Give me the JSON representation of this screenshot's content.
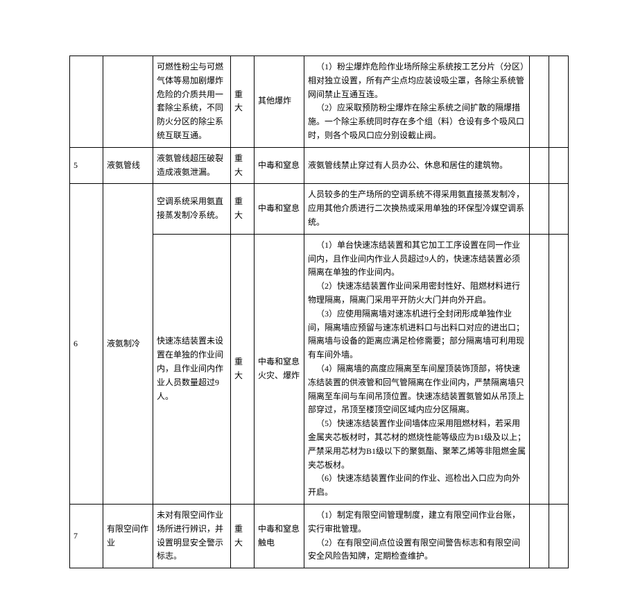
{
  "rows": [
    {
      "num": "",
      "item": "",
      "desc": "可燃性粉尘与可燃气体等易加剧爆炸危险的介质共用一套除尘系统，不同防火分区的除尘系统互联互通。",
      "level": "重大",
      "type": "其他爆炸",
      "measures": "（1）粉尘爆炸危险作业场所除尘系统按工艺分片（分区）相对独立设置，所有产尘点均应装设吸尘罩，各除尘系统管网间禁止互通互连。\n（2）应采取预防粉尘爆炸在除尘系统之间扩散的隔爆措施。一个除尘系统同时存在多个组（料）仓设有多个吸风口时，则各个吸风口应分别设截止阀。"
    },
    {
      "num": "5",
      "item": "液氨管线",
      "desc": "液氨管线超压破裂造成液氨泄漏。",
      "level": "重大",
      "type": "中毒和窒息",
      "measures": "液氨管线禁止穿过有人员办公、休息和居住的建筑物。"
    },
    {
      "num": "6",
      "item": "液氨制冷",
      "rowspan": 2,
      "sub": [
        {
          "desc": "空调系统采用氨直接蒸发制冷系统。",
          "level": "重大",
          "type": "中毒和窒息",
          "measures": "人员较多的生产场所的空调系统不得采用氨直接蒸发制冷，应用其他介质进行二次换热或采用单独的环保型冷媒空调系统。"
        },
        {
          "desc": "快速冻结装置未设置在单独的作业间内，且作业间内作业人员数量超过9人。",
          "level": "重大",
          "type": "中毒和窒息火灾、爆炸",
          "measures": "（1）单台快速冻结装置和其它加工工序设置在同一作业间内，且作业间内作业人员超过9人的，快速冻结装置必须隔离在单独的作业间内。\n（2）快速冻结装置作业间采用密封性好、阻燃材料进行物理隔离，隔离门采用平开防火大门并向外开启。\n（3）应使用隔离墙对速冻机进行全封闭形成单独作业间，隔离墙应预留与速冻机进料口与出料口对应的进出口；隔离墙与设备的距离应满足检修需要；部分隔离墙可利用现有车间外墙。\n（4）隔离墙的高度应隔离至车间屋顶装饰顶部，将快速冻结装置的供液管和回气管隔离在作业间内，严禁隔离墙只隔离至车间与车间吊顶位置。快速冻结装置氨管如从吊顶上部穿过，吊顶至楼顶空间区域内应分区隔离。\n（5）快速冻结装置作业间墙体应采用阻燃材料，若采用金属夹芯板材时，其芯材的燃烧性能等级应为B1级及以上；严禁采用芯材为B1级以下的聚氨酯、聚苯乙烯等非阻燃金属夹芯板材。\n（6）快速冻结装置作业间的作业、巡检出入口应为向外开启。"
        }
      ]
    },
    {
      "num": "7",
      "item": "有限空间作业",
      "desc": "未对有限空间作业场所进行辨识，并设置明显安全警示标志。",
      "level": "重大",
      "type": "中毒和窒息触电",
      "measures": "（1）制定有限空间管理制度，建立有限空间作业台账，实行审批管理。\n（2）在有限空间点位设置有限空间警告标志和有限空间安全风险告知牌，定期检查维护。"
    }
  ]
}
